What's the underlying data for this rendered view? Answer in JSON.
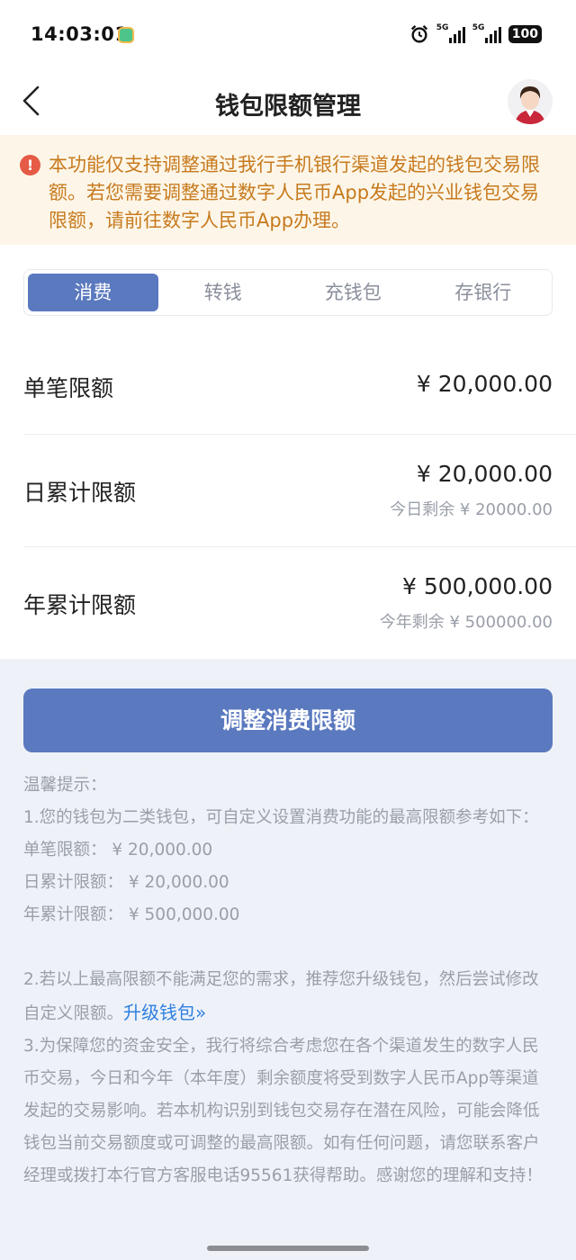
{
  "status_bar": {
    "time": "14:03:01",
    "battery": "100",
    "signal_1": "5G",
    "signal_2": "5G"
  },
  "header": {
    "title": "钱包限额管理"
  },
  "notice": {
    "text": "本功能仅支持调整通过我行手机银行渠道发起的钱包交易限额。若您需要调整通过数字人民币App发起的兴业钱包交易限额，请前往数字人民币App办理。"
  },
  "tabs": [
    {
      "label": "消费",
      "active": true
    },
    {
      "label": "转钱",
      "active": false
    },
    {
      "label": "充钱包",
      "active": false
    },
    {
      "label": "存银行",
      "active": false
    }
  ],
  "limits": {
    "single": {
      "label": "单笔限额",
      "value": "¥ 20,000.00"
    },
    "daily": {
      "label": "日累计限额",
      "value": "¥ 20,000.00",
      "remaining": "今日剩余 ¥ 20000.00"
    },
    "yearly": {
      "label": "年累计限额",
      "value": "¥ 500,000.00",
      "remaining": "今年剩余 ¥ 500000.00"
    }
  },
  "adjust_button": "调整消费限额",
  "tips": {
    "title": "温馨提示：",
    "item1": "1.您的钱包为二类钱包，可自定义设置消费功能的最高限额参考如下：",
    "single": "单笔限额： ¥ 20,000.00",
    "daily": "日累计限额： ¥ 20,000.00",
    "yearly": "年累计限额： ¥ 500,000.00",
    "item2": "2.若以上最高限额不能满足您的需求，推荐您升级钱包，然后尝试修改自定义限额。",
    "upgrade_link": "升级钱包»",
    "item3": "3.为保障您的资金安全，我行将综合考虑您在各个渠道发生的数字人民币交易，今日和今年（本年度）剩余额度将受到数字人民币App等渠道发起的交易影响。若本机构识别到钱包交易存在潜在风险，可能会降低钱包当前交易额度或可调整的最高限额。如有任何问题，请您联系客户经理或拨打本行官方客服电话95561获得帮助。感谢您的理解和支持！"
  },
  "colors": {
    "primary": "#5a79bf",
    "notice_bg": "#fdf6e8",
    "notice_text": "#c77a1e",
    "warning": "#e65b45",
    "link": "#2f7fe0"
  }
}
